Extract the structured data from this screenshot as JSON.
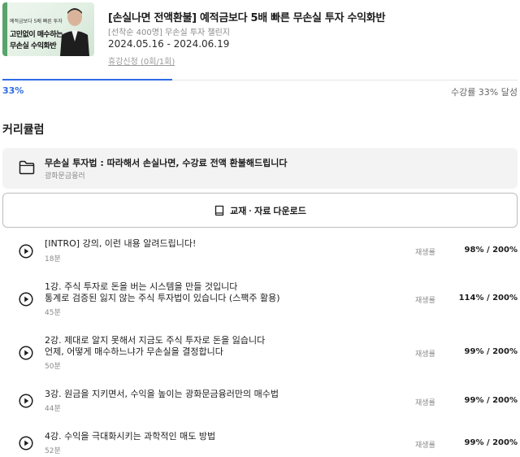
{
  "course": {
    "title": "[손실나면 전액환불] 예적금보다 5배 빠른 무손실 투자 수익화반",
    "subtitle": "[선착순 400명] 무손실 투자 챌린지",
    "dates": "2024.05.16 - 2024.06.19",
    "leave_link": "휴강신청 (0회/1회)",
    "thumbnail": {
      "line1": "예적금보다 5배 빠른 투자",
      "line2": "고민없이 매수하는",
      "line3": "무손실 수익화반"
    }
  },
  "progress": {
    "percent_label": "33%",
    "percent": 33,
    "text": "수강률 33% 달성"
  },
  "curriculum": {
    "heading": "커리큘럼",
    "section": {
      "icon": "folder-icon",
      "title": "무손실 투자법 : 따라해서 손실나면, 수강료 전액 환불해드립니다",
      "author": "광화문금융러"
    },
    "download": {
      "icon": "book-icon",
      "label": "교재 · 자료 다운로드"
    },
    "lessons": [
      {
        "line1": "[INTRO] 강의, 이런 내용 알려드립니다!",
        "line2": "",
        "duration": "18분",
        "rate_label": "재생률",
        "rate": "98% / 200%"
      },
      {
        "line1": "1강. 주식 투자로 돈을 버는 시스템을 만들 것입니다",
        "line2": "통계로 검증된 잃지 않는 주식 투자법이 있습니다 (스팩주 활용)",
        "duration": "45분",
        "rate_label": "재생률",
        "rate": "114% / 200%"
      },
      {
        "line1": "2강. 제대로 알지 못해서 지금도 주식 투자로 돈을 잃습니다",
        "line2": "언제, 어떻게 매수하느냐가 무손실을 결정합니다",
        "duration": "50분",
        "rate_label": "재생률",
        "rate": "99% / 200%"
      },
      {
        "line1": "3강. 원금을 지키면서, 수익을 높이는 광화문금융러만의 매수법",
        "line2": "",
        "duration": "44분",
        "rate_label": "재생률",
        "rate": "99% / 200%"
      },
      {
        "line1": "4강. 수익을 극대화시키는 과학적인 매도 방법",
        "line2": "",
        "duration": "52분",
        "rate_label": "재생률",
        "rate": "99% / 200%"
      }
    ]
  },
  "colors": {
    "accent": "#2e6ae6",
    "section_bg": "#f3f3f3"
  }
}
